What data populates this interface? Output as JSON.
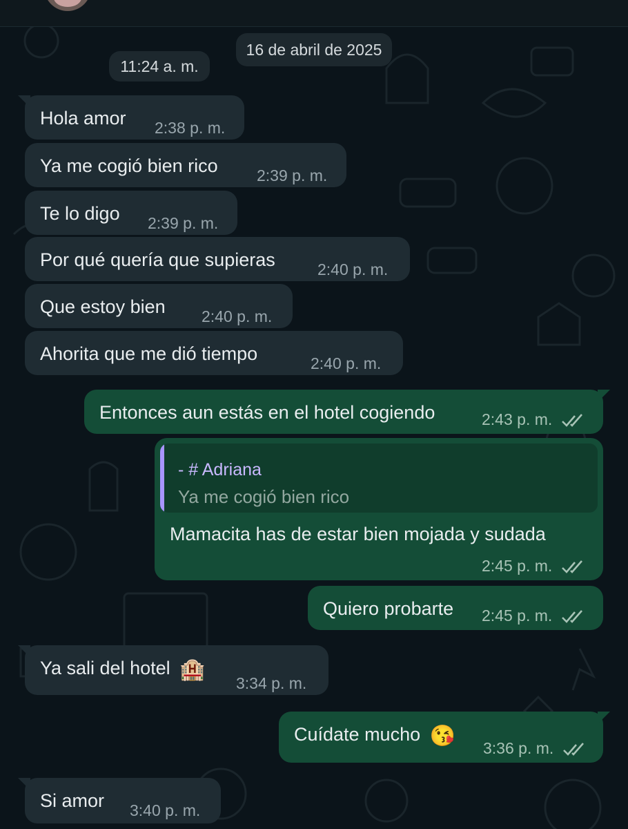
{
  "header": {
    "contact_avatar": "avatar-photo"
  },
  "chat": {
    "date_label": "16 de abril de 2025",
    "first_time_label": "11:24 a. m.",
    "messages": [
      {
        "dir": "in",
        "text": "Hola amor",
        "time": "2:38 p. m."
      },
      {
        "dir": "in",
        "text": "Ya me cogió bien rico",
        "time": "2:39 p. m."
      },
      {
        "dir": "in",
        "text": "Te lo digo",
        "time": "2:39 p. m."
      },
      {
        "dir": "in",
        "text": "Por qué quería que supieras",
        "time": "2:40 p. m."
      },
      {
        "dir": "in",
        "text": "Que estoy bien",
        "time": "2:40 p. m."
      },
      {
        "dir": "in",
        "text": "Ahorita que me dió tiempo",
        "time": "2:40 p. m."
      },
      {
        "dir": "out",
        "text": "Entonces aun estás en el hotel cogiendo",
        "time": "2:43 p. m.",
        "status": "read"
      },
      {
        "dir": "out",
        "text": "Mamacita has de estar bien mojada y sudada",
        "time": "2:45 p. m.",
        "status": "read",
        "reply_to": {
          "sender": "- #  Adriana",
          "text": "Ya me cogió bien rico"
        }
      },
      {
        "dir": "out",
        "text": "Quiero probarte",
        "time": "2:45 p. m.",
        "status": "read"
      },
      {
        "dir": "in",
        "text": "Ya sali del hotel",
        "emoji": "🏨",
        "time": "3:34 p. m."
      },
      {
        "dir": "out",
        "text": "Cuídate mucho",
        "emoji": "😘",
        "time": "3:36 p. m.",
        "status": "read"
      },
      {
        "dir": "in",
        "text": "Si amor",
        "time": "3:40 p. m."
      }
    ]
  },
  "colors": {
    "background": "#0b141a",
    "incoming_bubble": "#1f2c33",
    "outgoing_bubble": "#144d37",
    "read_ticks": "#a8c3b6",
    "reply_accent": "#a895ff"
  }
}
